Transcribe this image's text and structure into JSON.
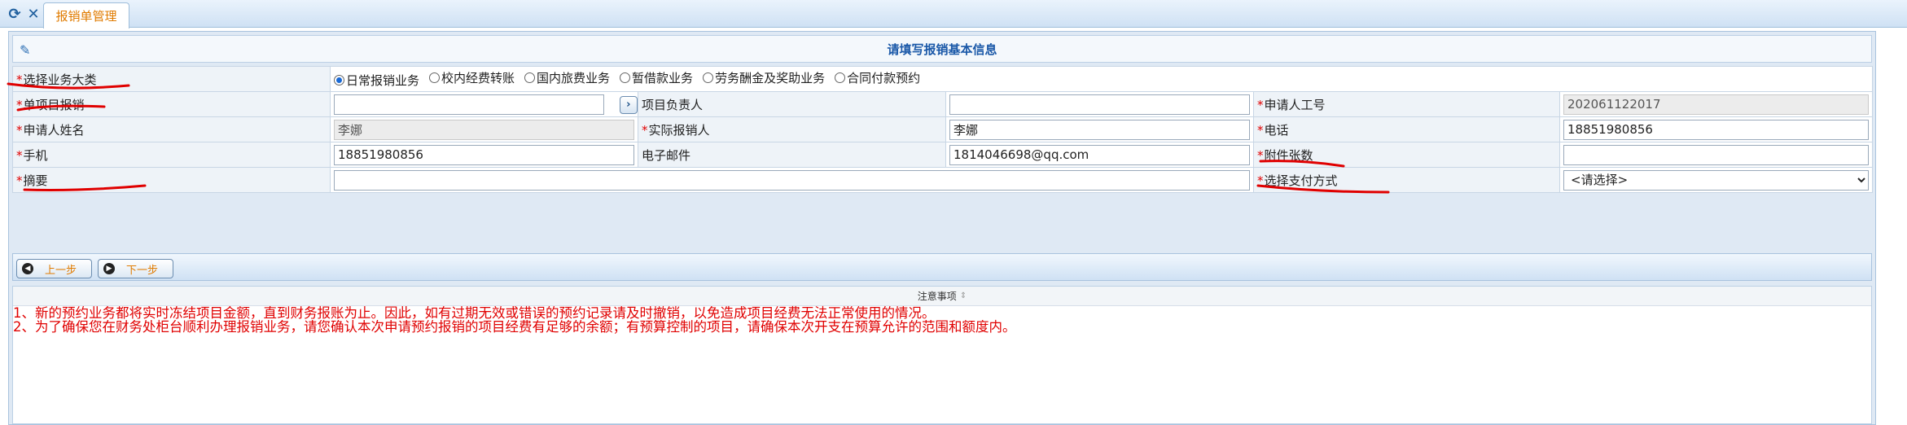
{
  "tab": {
    "label": "报销单管理"
  },
  "form": {
    "title": "请填写报销基本信息",
    "business_category": {
      "label": "选择业务大类",
      "options": [
        "日常报销业务",
        "校内经费转账",
        "国内旅费业务",
        "暂借款业务",
        "劳务酬金及奖助业务",
        "合同付款预约"
      ],
      "selected": "日常报销业务"
    },
    "single_project": {
      "label": "单项目报销",
      "value": ""
    },
    "project_leader": {
      "label": "项目负责人",
      "value": ""
    },
    "applicant_id": {
      "label": "申请人工号",
      "value": "202061122017"
    },
    "applicant_name": {
      "label": "申请人姓名",
      "value": "李娜"
    },
    "actual_claimant": {
      "label": "实际报销人",
      "value": "李娜"
    },
    "phone": {
      "label": "电话",
      "value": "18851980856"
    },
    "mobile": {
      "label": "手机",
      "value": "18851980856"
    },
    "email": {
      "label": "电子邮件",
      "value": "1814046698@qq.com"
    },
    "attachments": {
      "label": "附件张数",
      "value": ""
    },
    "summary": {
      "label": "摘要",
      "value": ""
    },
    "payment_method": {
      "label": "选择支付方式",
      "value": "<请选择>"
    }
  },
  "buttons": {
    "prev": "上一步",
    "next": "下一步"
  },
  "notice": {
    "title": "注意事项",
    "lines": [
      "1、新的预约业务都将实时冻结项目金额，直到财务报账为止。因此，如有过期无效或错误的预约记录请及时撤销，以免造成项目经费无法正常使用的情况。",
      "2、为了确保您在财务处柜台顺利办理报销业务，请您确认本次申请预约报销的项目经费有足够的余额；有预算控制的项目，请确保本次开支在预算允许的范围和额度内。"
    ]
  },
  "colors": {
    "required": "#e00000",
    "tab_active": "#e07b00",
    "header_text": "#1a58a8",
    "annotation": "#e00000"
  }
}
